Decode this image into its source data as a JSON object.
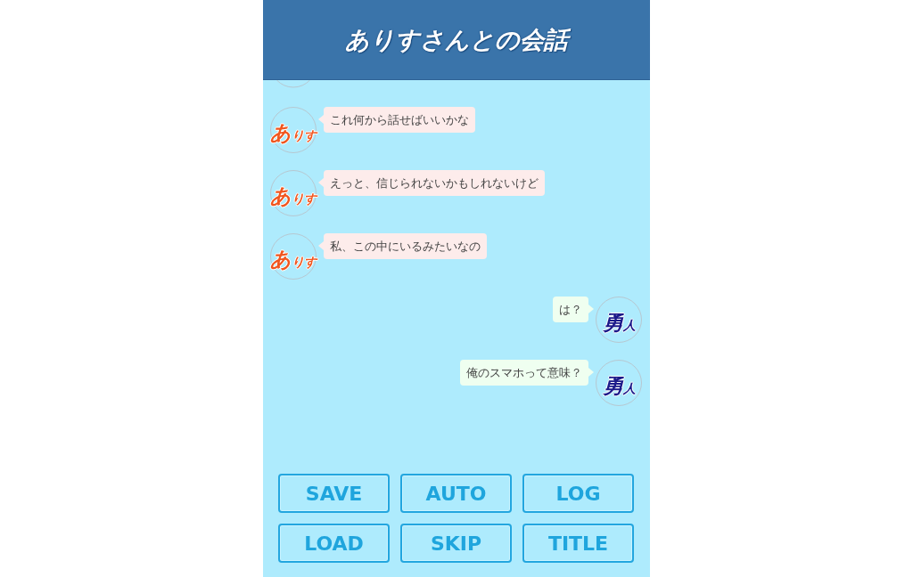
{
  "header": {
    "title": "ありすさんとの会話"
  },
  "messages": [
    {
      "kind": "received",
      "avatar": {
        "initial": "あ",
        "rest": "りす",
        "color": "#f0561f"
      },
      "text": "これ何から話せばいいかな"
    },
    {
      "kind": "received",
      "avatar": {
        "initial": "あ",
        "rest": "りす",
        "color": "#f0561f"
      },
      "text": "えっと、信じられないかもしれないけど"
    },
    {
      "kind": "received",
      "avatar": {
        "initial": "あ",
        "rest": "りす",
        "color": "#f0561f"
      },
      "text": "私、この中にいるみたいなの"
    },
    {
      "kind": "sent",
      "avatar": {
        "initial": "勇",
        "rest": "人",
        "color": "#1c1a8a"
      },
      "text": "は？"
    },
    {
      "kind": "sent",
      "avatar": {
        "initial": "勇",
        "rest": "人",
        "color": "#1c1a8a"
      },
      "text": "俺のスマホって意味？"
    }
  ],
  "buttons": [
    "SAVE",
    "AUTO",
    "LOG",
    "LOAD",
    "SKIP",
    "TITLE"
  ]
}
